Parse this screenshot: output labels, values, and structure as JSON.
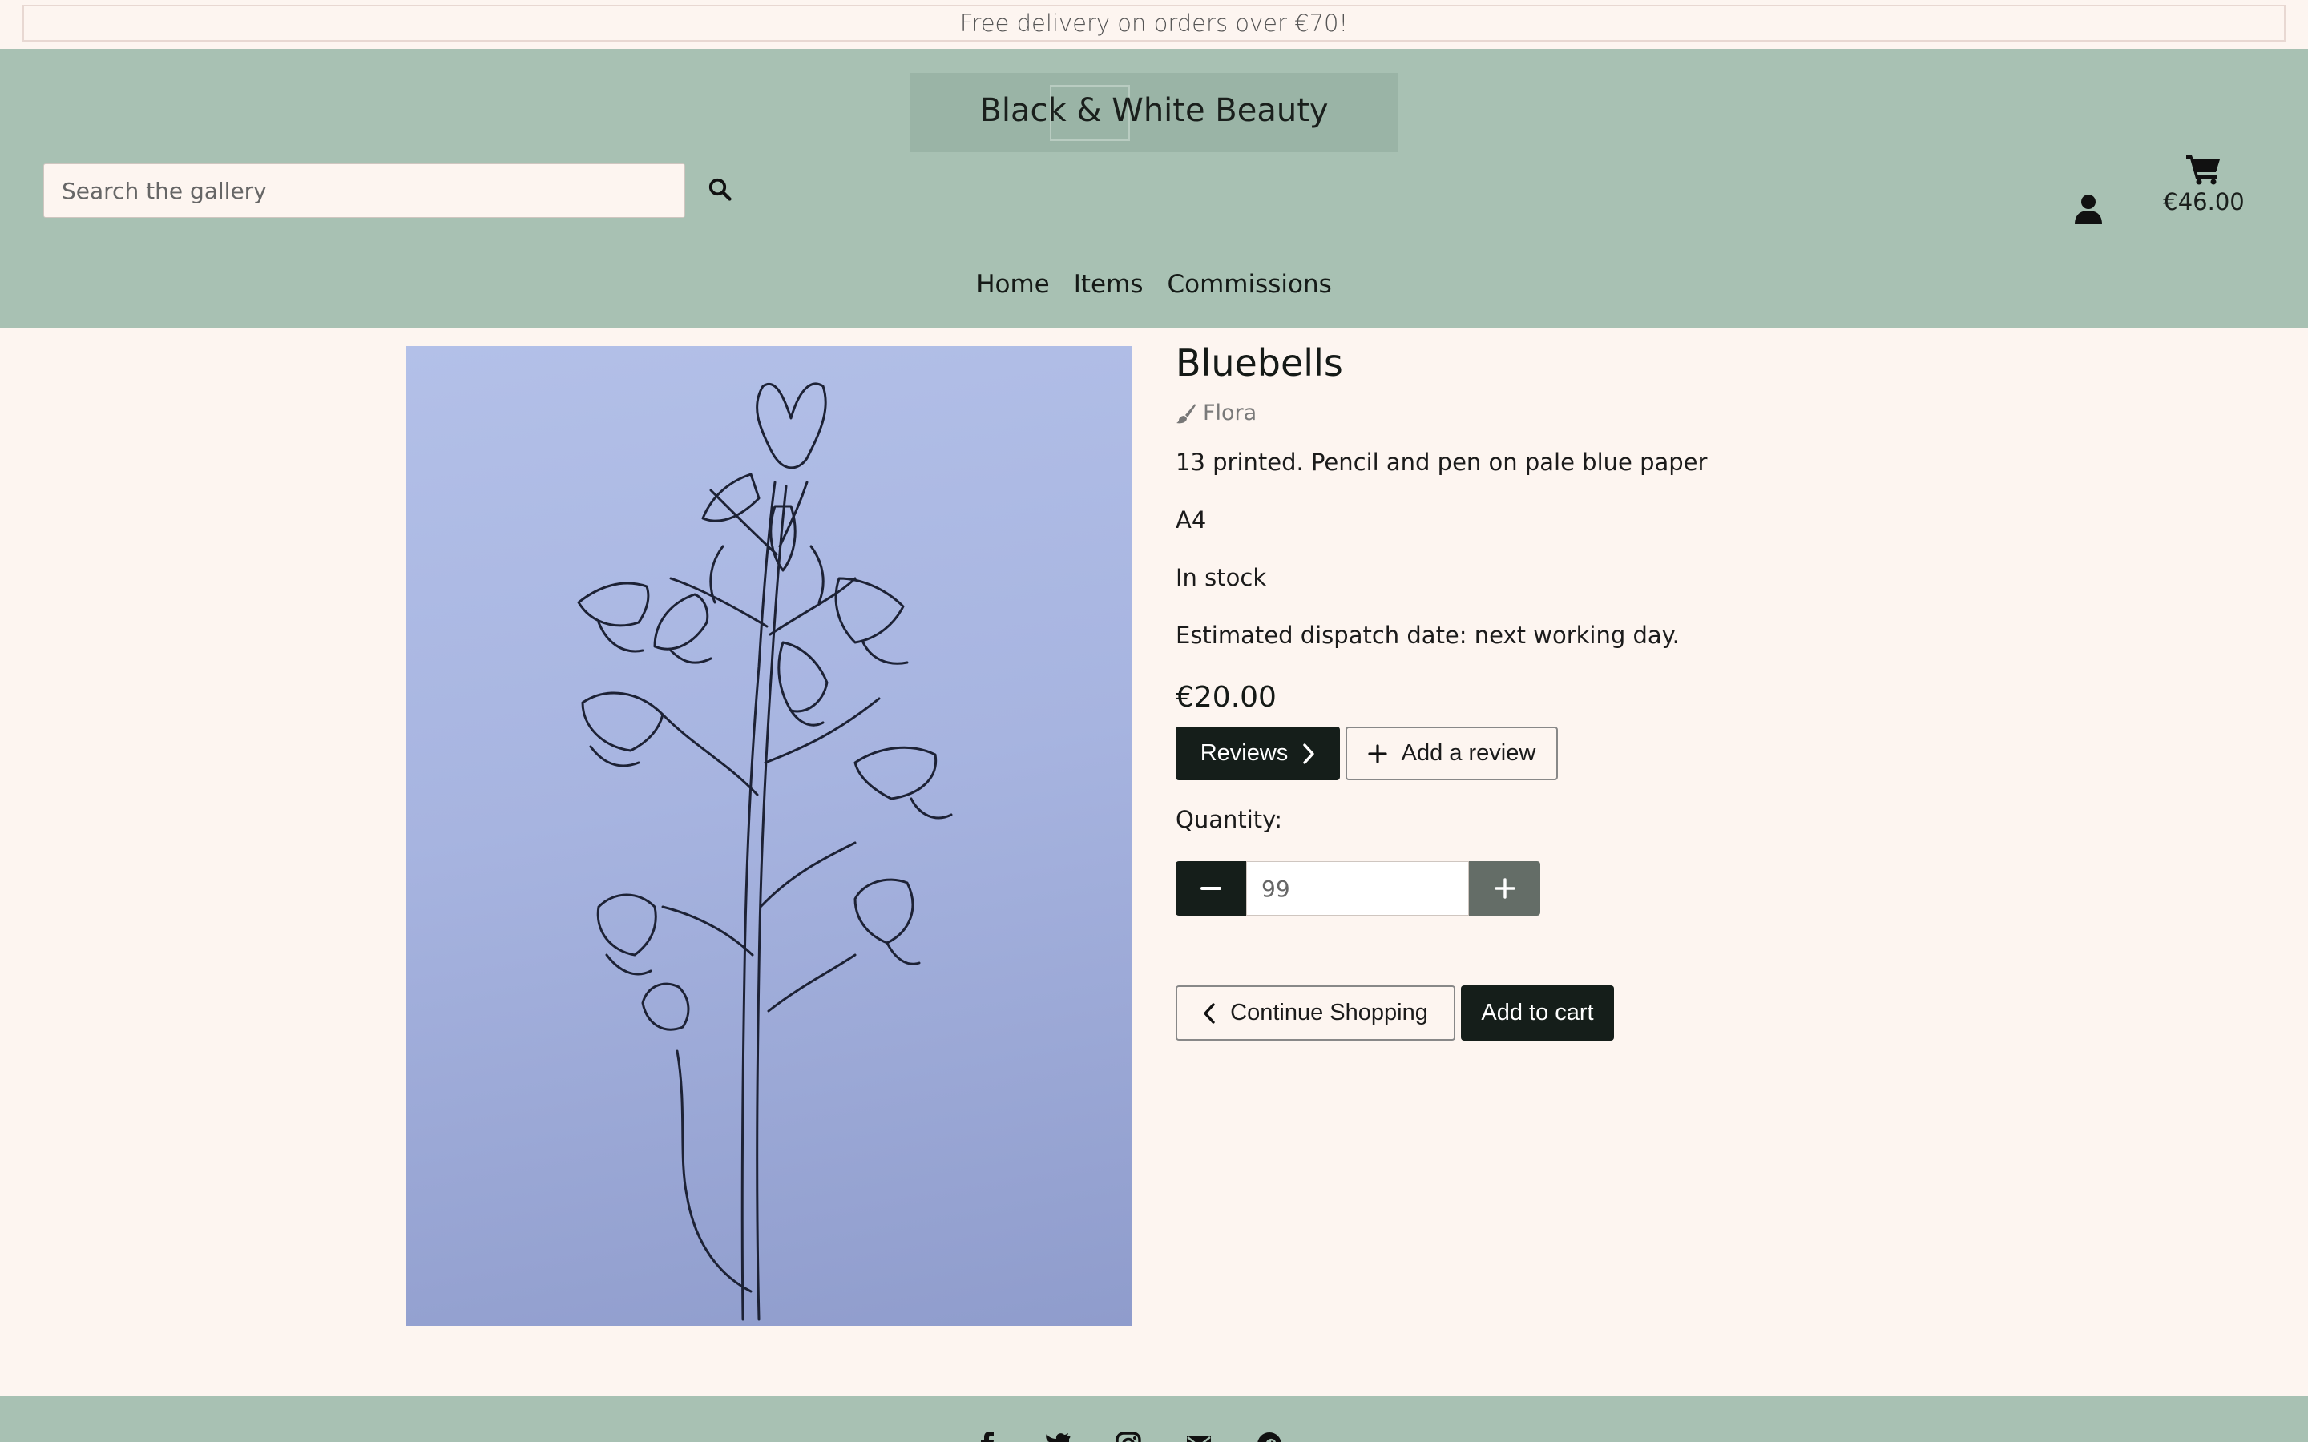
{
  "promo": {
    "text": "Free delivery on orders over €70!"
  },
  "header": {
    "logo_title": "Black & White Beauty",
    "search": {
      "placeholder": "Search the gallery",
      "value": ""
    },
    "cart_total": "€46.00"
  },
  "nav": {
    "items": [
      "Home",
      "Items",
      "Commissions"
    ]
  },
  "product": {
    "image_alt": "Bluebells",
    "title": "Bluebells",
    "category": "Flora",
    "description": "13 printed. Pencil and pen on pale blue paper",
    "size": "A4",
    "stock": "In stock",
    "dispatch": "Estimated dispatch date: next working day.",
    "price": "€20.00",
    "reviews_label": "Reviews",
    "add_review_label": "Add a review",
    "quantity_label": "Quantity:",
    "quantity_placeholder": "99",
    "continue_label": "Continue Shopping",
    "add_to_cart_label": "Add to cart"
  },
  "icons": {
    "search": "search-icon",
    "account": "user-icon",
    "cart": "cart-icon",
    "category": "paintbrush-icon",
    "reviews": "chevron-right-icon",
    "add_review": "plus-icon",
    "decrement": "minus-icon",
    "increment": "plus-icon",
    "continue": "chevron-left-icon",
    "footer": [
      "facebook-icon",
      "twitter-icon",
      "instagram-icon",
      "email-icon",
      "pinterest-icon"
    ]
  },
  "colors": {
    "page_bg": "#fdf5f0",
    "header_bg": "#a8c1b3",
    "dark_button": "#151e1a",
    "grey_button": "#646d67"
  }
}
